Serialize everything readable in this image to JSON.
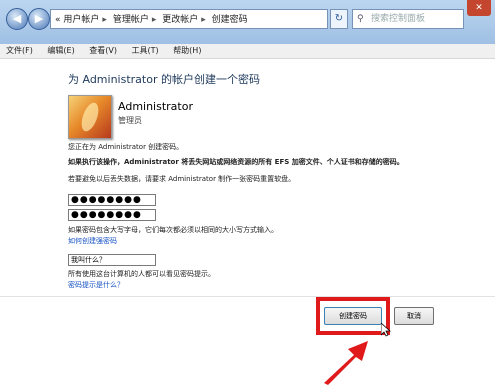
{
  "window": {
    "back_icon": "back-arrow-icon",
    "forward_icon": "forward-arrow-icon",
    "close_label": "✕"
  },
  "address": {
    "prefix": "«",
    "crumbs": [
      "用户帐户",
      "管理帐户",
      "更改帐户",
      "创建密码"
    ],
    "refresh_icon": "↻"
  },
  "search": {
    "placeholder": "搜索控制面板"
  },
  "menu": {
    "items": [
      "文件(F)",
      "编辑(E)",
      "查看(V)",
      "工具(T)",
      "帮助(H)"
    ]
  },
  "page": {
    "heading": "为 Administrator 的帐户创建一个密码",
    "user_name": "Administrator",
    "user_role": "管理员",
    "line1": "您正在为 Administrator 创建密码。",
    "warning": "如果执行该操作，Administrator 将丢失网站或网络资源的所有 EFS 加密文件、个人证书和存储的密码。",
    "line3": "若要避免以后丢失数据，请要求 Administrator 制作一张密码重置软盘。",
    "password_value": "●●●●●●●●",
    "confirm_value": "●●●●●●●●",
    "case_note": "如果密码包含大写字母，它们每次都必须以相同的大小写方式输入。",
    "link_strong": "如何创建强密码",
    "hint_value": "我叫什么？",
    "hint_note": "所有使用这台计算机的人都可以看见密码提示。",
    "link_hint": "密码提示是什么？"
  },
  "buttons": {
    "create": "创建密码",
    "cancel": "取消"
  },
  "colors": {
    "highlight": "#e0191a",
    "link": "#1552c4",
    "titlebar": "#9fc0e4"
  }
}
